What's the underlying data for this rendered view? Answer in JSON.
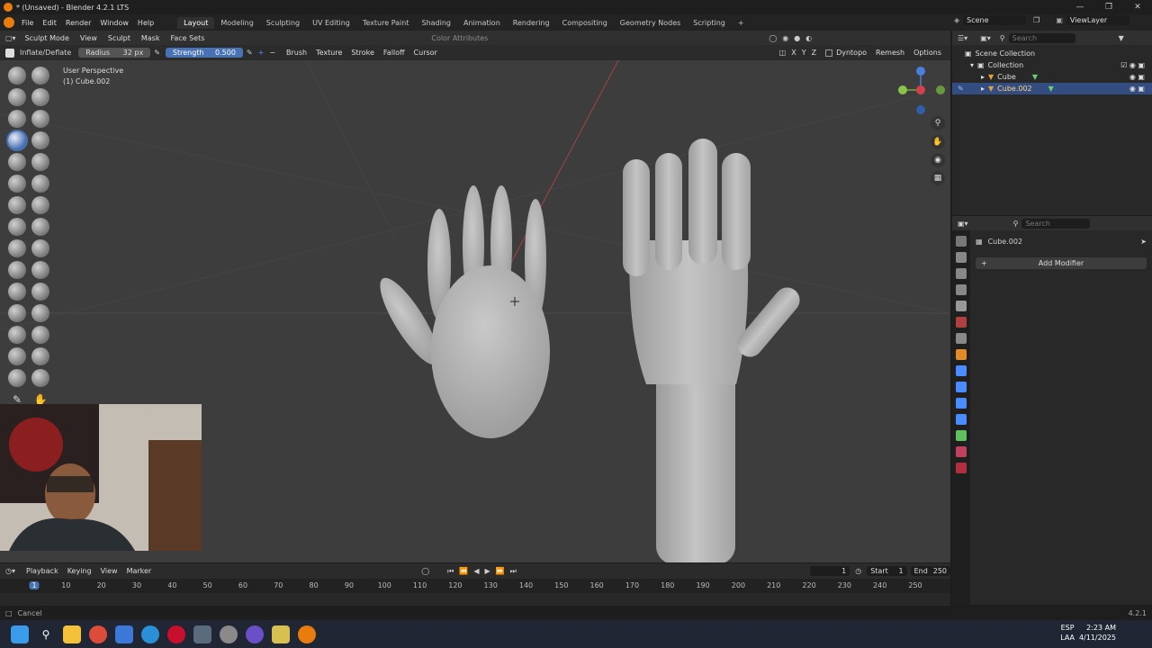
{
  "window": {
    "title": "* (Unsaved) - Blender 4.2.1 LTS"
  },
  "menu": {
    "items": [
      "File",
      "Edit",
      "Render",
      "Window",
      "Help"
    ]
  },
  "workspaces": [
    "Layout",
    "Modeling",
    "Sculpting",
    "UV Editing",
    "Texture Paint",
    "Shading",
    "Animation",
    "Rendering",
    "Compositing",
    "Geometry Nodes",
    "Scripting"
  ],
  "active_workspace": "Layout",
  "scene": {
    "scene_name": "Scene",
    "view_layer": "ViewLayer"
  },
  "viewport_header": {
    "mode": "Sculpt Mode",
    "items": [
      "View",
      "Sculpt",
      "Mask",
      "Face Sets"
    ],
    "color_attributes": "Color Attributes"
  },
  "tool_header": {
    "brush_name": "Inflate/Deflate",
    "radius_label": "Radius",
    "radius_value": "32 px",
    "strength_label": "Strength",
    "strength_value": "0.500",
    "menus": [
      "Brush",
      "Texture",
      "Stroke",
      "Falloff",
      "Cursor"
    ],
    "axes": [
      "X",
      "Y",
      "Z"
    ],
    "dyntopo": "Dyntopo",
    "remesh": "Remesh",
    "options": "Options"
  },
  "viewport": {
    "perspective": "User Perspective",
    "object": "(1) Cube.002"
  },
  "timeline": {
    "menus": [
      "Playback",
      "Keying",
      "View",
      "Marker"
    ],
    "current_frame": "1",
    "start_label": "Start",
    "start_value": "1",
    "end_label": "End",
    "end_value": "250",
    "ticks": [
      "1",
      "10",
      "20",
      "30",
      "40",
      "50",
      "60",
      "70",
      "80",
      "90",
      "100",
      "110",
      "120",
      "130",
      "140",
      "150",
      "160",
      "170",
      "180",
      "190",
      "200",
      "210",
      "220",
      "230",
      "240",
      "250"
    ]
  },
  "status": {
    "left": "Cancel",
    "version": "4.2.1"
  },
  "outliner": {
    "search_placeholder": "Search",
    "root": "Scene Collection",
    "collection": "Collection",
    "objects": [
      "Cube",
      "Cube.002"
    ],
    "selected": "Cube.002"
  },
  "properties": {
    "search_placeholder": "Search",
    "object_name": "Cube.002",
    "add_modifier": "Add Modifier"
  },
  "taskbar": {
    "lang1": "ESP",
    "lang2": "LAA",
    "time": "2:23 AM",
    "date": "4/11/2025"
  },
  "colors": {
    "accent": "#4772b3",
    "selected_row": "#334d80",
    "blender_orange": "#e87d0d",
    "viewport_bg": "#3d3d3d"
  }
}
